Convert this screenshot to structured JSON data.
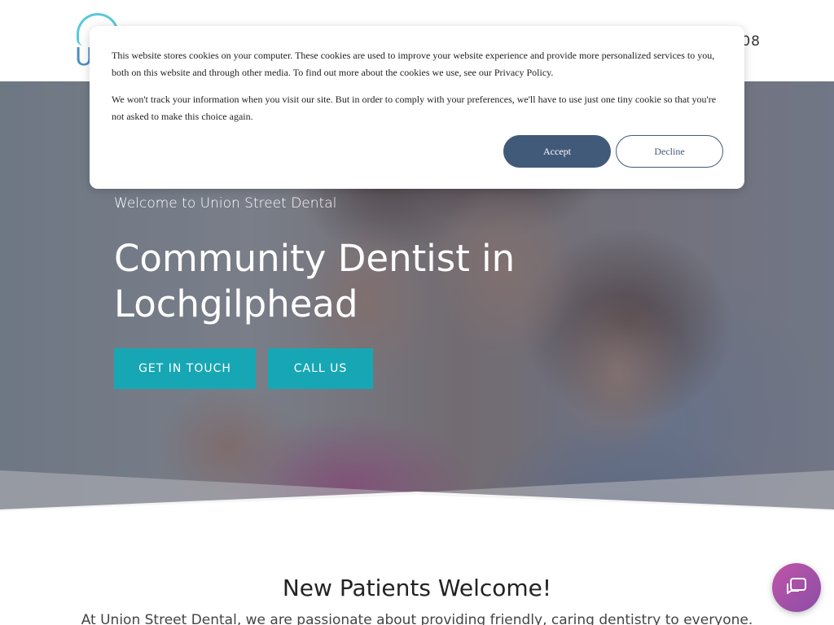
{
  "header": {
    "logo_letter": "U",
    "phone_fragment": "08"
  },
  "hero": {
    "eyebrow": "Welcome to Union Street Dental",
    "title": "Community Dentist in Lochgilphead",
    "buttons": {
      "get_in_touch": "GET IN TOUCH",
      "call_us": "CALL US"
    }
  },
  "section": {
    "title": "New Patients Welcome!",
    "text": "At Union Street Dental, we are passionate about providing friendly, caring dentistry to everyone."
  },
  "cookie_banner": {
    "paragraph_1": "This website stores cookies on your computer. These cookies are used to improve your website experience and provide more personalized services to you, both on this website and through other media. To find out more about the cookies we use, see our Privacy Policy.",
    "paragraph_2": "We won't track your information when you visit our site. But in order to comply with your preferences, we'll have to use just one tiny cookie so that you're not asked to make this choice again.",
    "accept_label": "Accept",
    "decline_label": "Decline"
  },
  "colors": {
    "teal_button": "#17a7b4",
    "cookie_button": "#425a7a",
    "chat_widget": "#a452a8"
  },
  "icons": {
    "chat": "chat-bubble-icon",
    "logo": "tooth-logo-icon"
  }
}
